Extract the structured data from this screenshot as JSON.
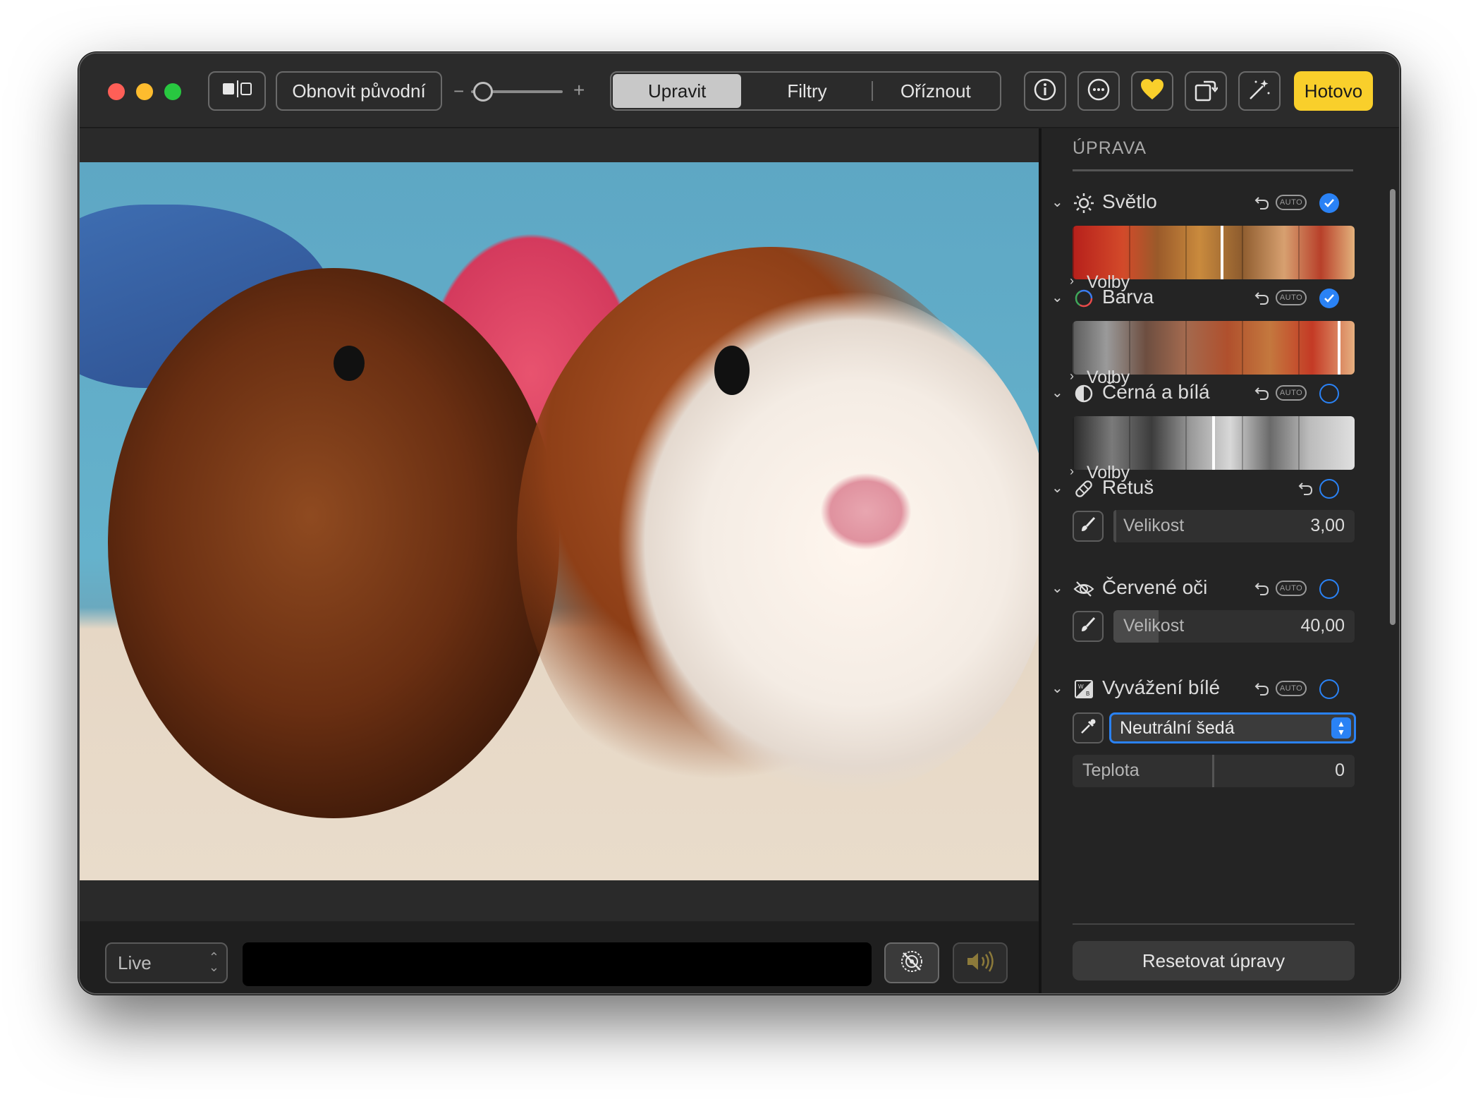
{
  "toolbar": {
    "revert_label": "Obnovit původní",
    "zoom_minus": "−",
    "zoom_plus": "+",
    "zoom_level": 0.05,
    "tabs": [
      {
        "label": "Upravit",
        "active": true
      },
      {
        "label": "Filtry",
        "active": false
      },
      {
        "label": "Oříznout",
        "active": false
      }
    ],
    "icons": [
      "split-view-icon",
      "info-icon",
      "more-icon",
      "heart-icon",
      "rotate-icon",
      "magic-wand-icon"
    ],
    "done_label": "Hotovo",
    "accent_color": "#f9cf2b"
  },
  "live_bar": {
    "mode_label": "Live",
    "icons": [
      "live-off-icon",
      "speaker-icon"
    ]
  },
  "panel": {
    "title": "ÚPRAVA",
    "check_color": "#2a82f5",
    "auto_label": "AUTO",
    "sections": [
      {
        "label": "Světlo",
        "icon": "sun-icon",
        "checked": true,
        "options_label": "Volby"
      },
      {
        "label": "Barva",
        "icon": "color-ring-icon",
        "checked": true,
        "options_label": "Volby"
      },
      {
        "label": "Černá a bílá",
        "icon": "half-circle-icon",
        "checked": false,
        "options_label": "Volby"
      },
      {
        "label": "Retuš",
        "icon": "bandage-icon",
        "checked": false,
        "size_label": "Velikost",
        "size_value": "3,00"
      },
      {
        "label": "Červené oči",
        "icon": "eye-slash-icon",
        "checked": false,
        "size_label": "Velikost",
        "size_value": "40,00"
      },
      {
        "label": "Vyvážení bílé",
        "icon": "white-balance-icon",
        "checked": false,
        "select_value": "Neutrální šedá",
        "temp_label": "Teplota",
        "temp_value": "0"
      }
    ],
    "reset_label": "Resetovat úpravy"
  }
}
